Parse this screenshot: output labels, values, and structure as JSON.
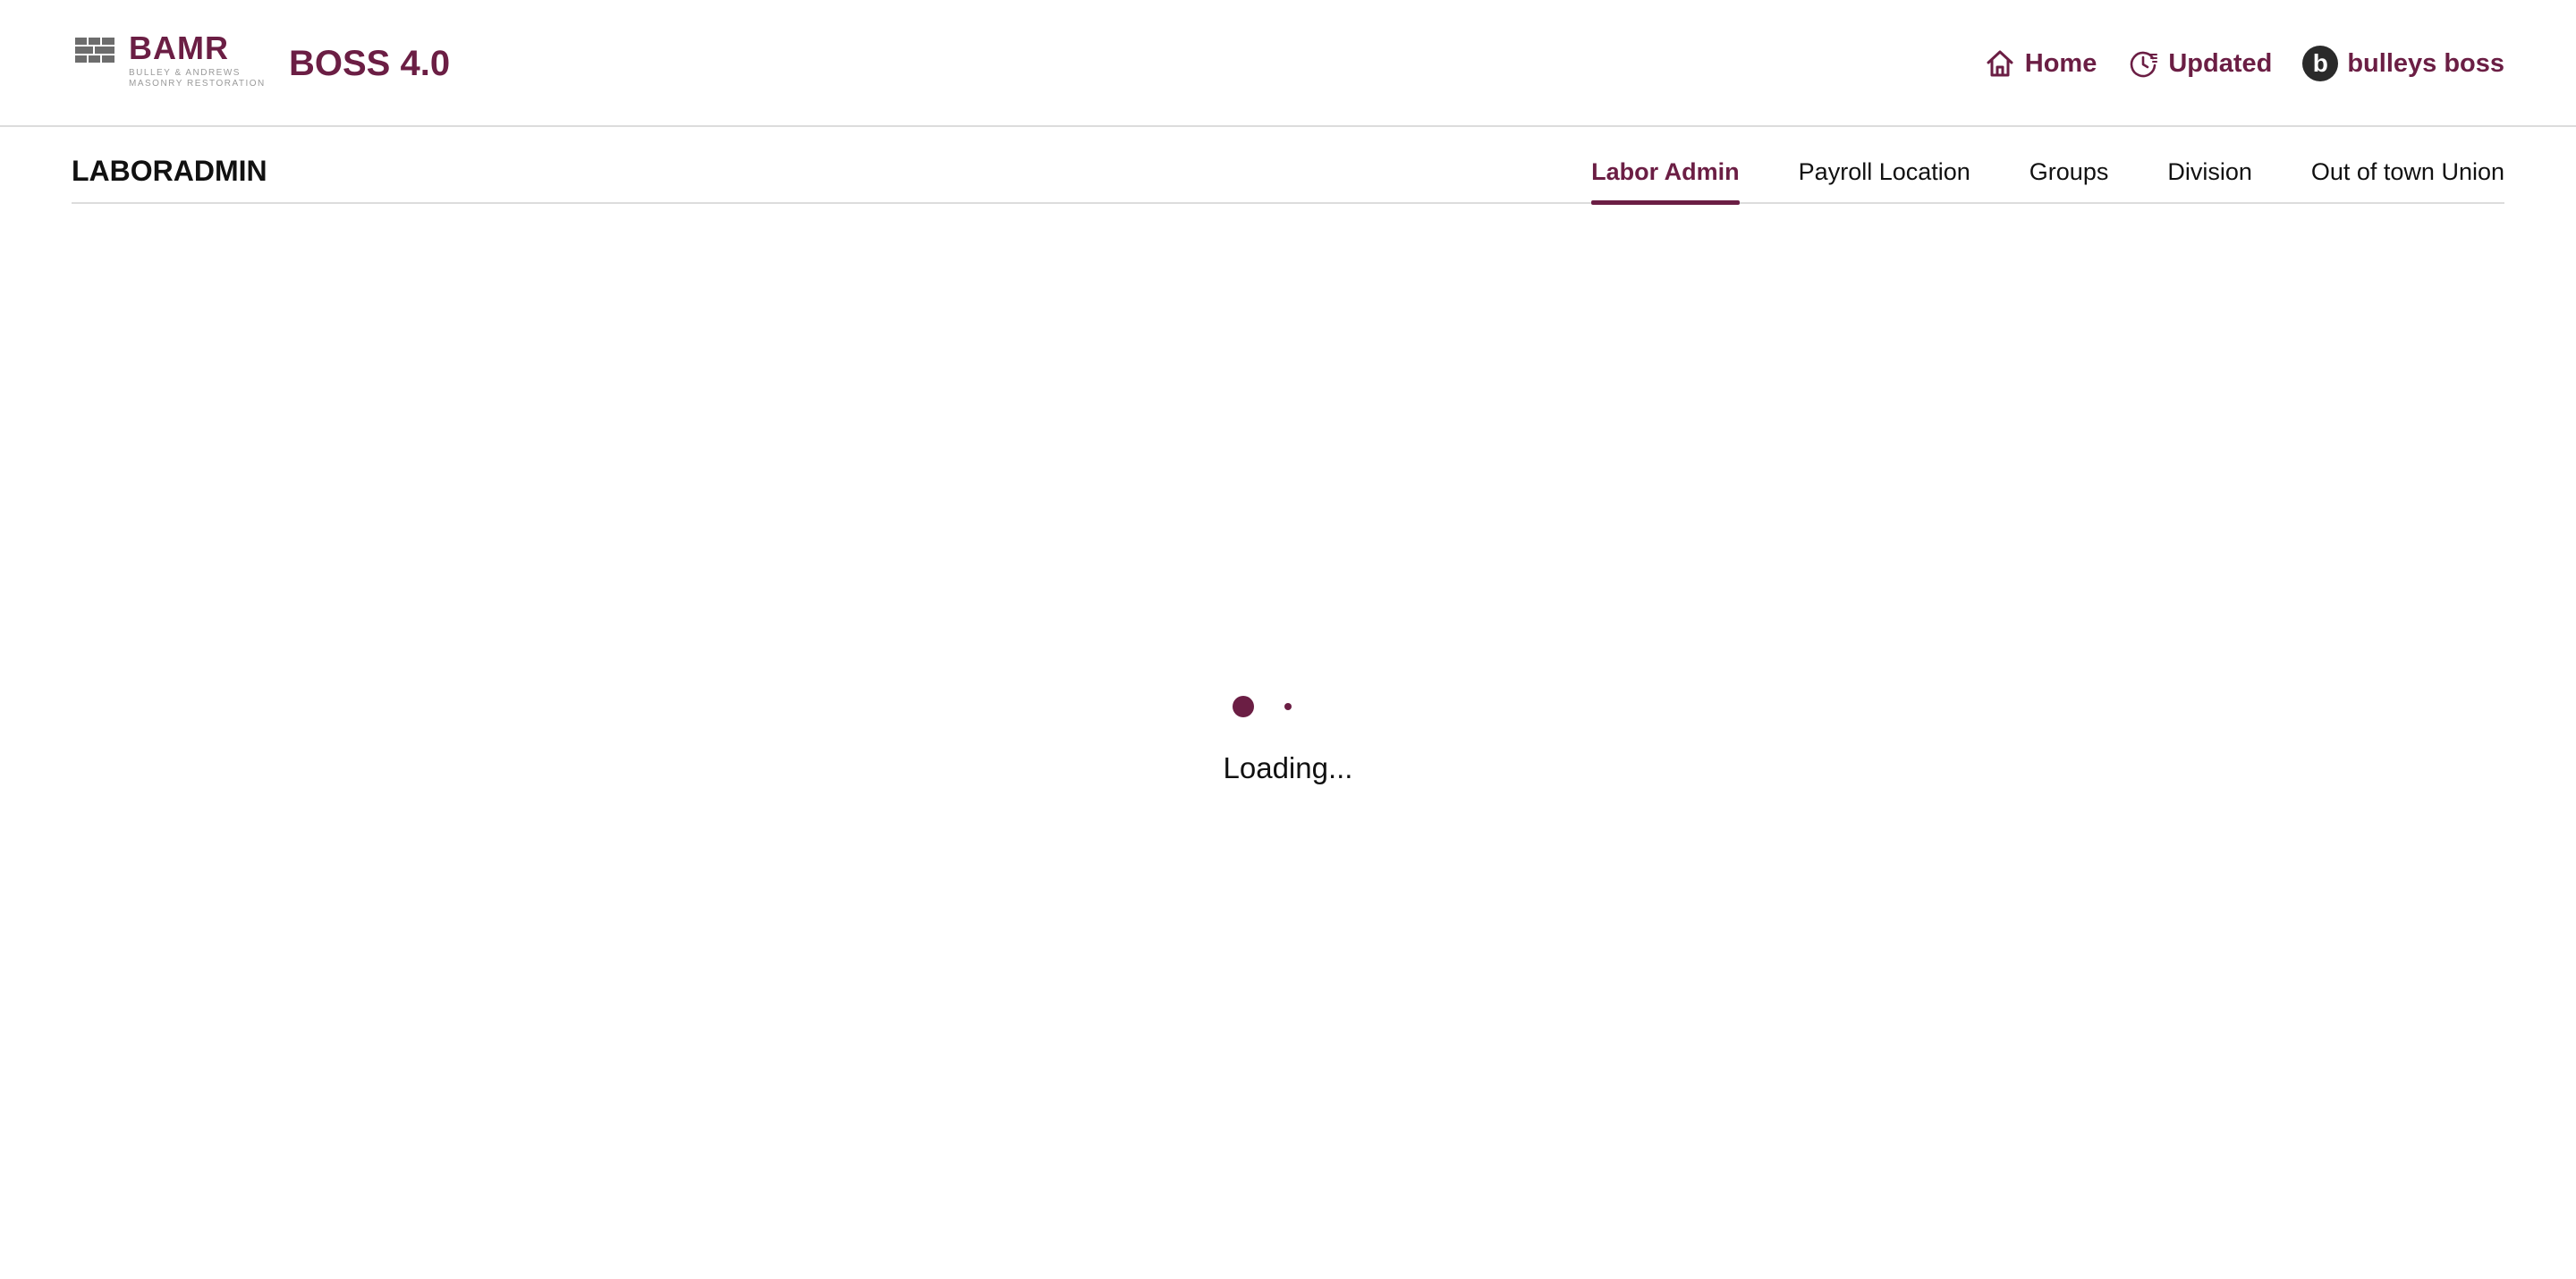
{
  "brand": {
    "logo_word": "BAMR",
    "logo_sub_line1": "BULLEY & ANDREWS",
    "logo_sub_line2": "MASONRY RESTORATION",
    "app_title": "BOSS 4.0",
    "accent_color": "#6b1e44"
  },
  "header_nav": {
    "home_label": "Home",
    "home_icon": "home-icon",
    "updated_label": "Updated",
    "updated_icon": "history-icon",
    "user_initial": "b",
    "user_name": "bulleys boss"
  },
  "page": {
    "title": "LABORADMIN"
  },
  "tabs": [
    {
      "label": "Labor Admin",
      "active": true
    },
    {
      "label": "Payroll Location",
      "active": false
    },
    {
      "label": "Groups",
      "active": false
    },
    {
      "label": "Division",
      "active": false
    },
    {
      "label": "Out of town Union",
      "active": false
    }
  ],
  "loader": {
    "text": "Loading..."
  }
}
